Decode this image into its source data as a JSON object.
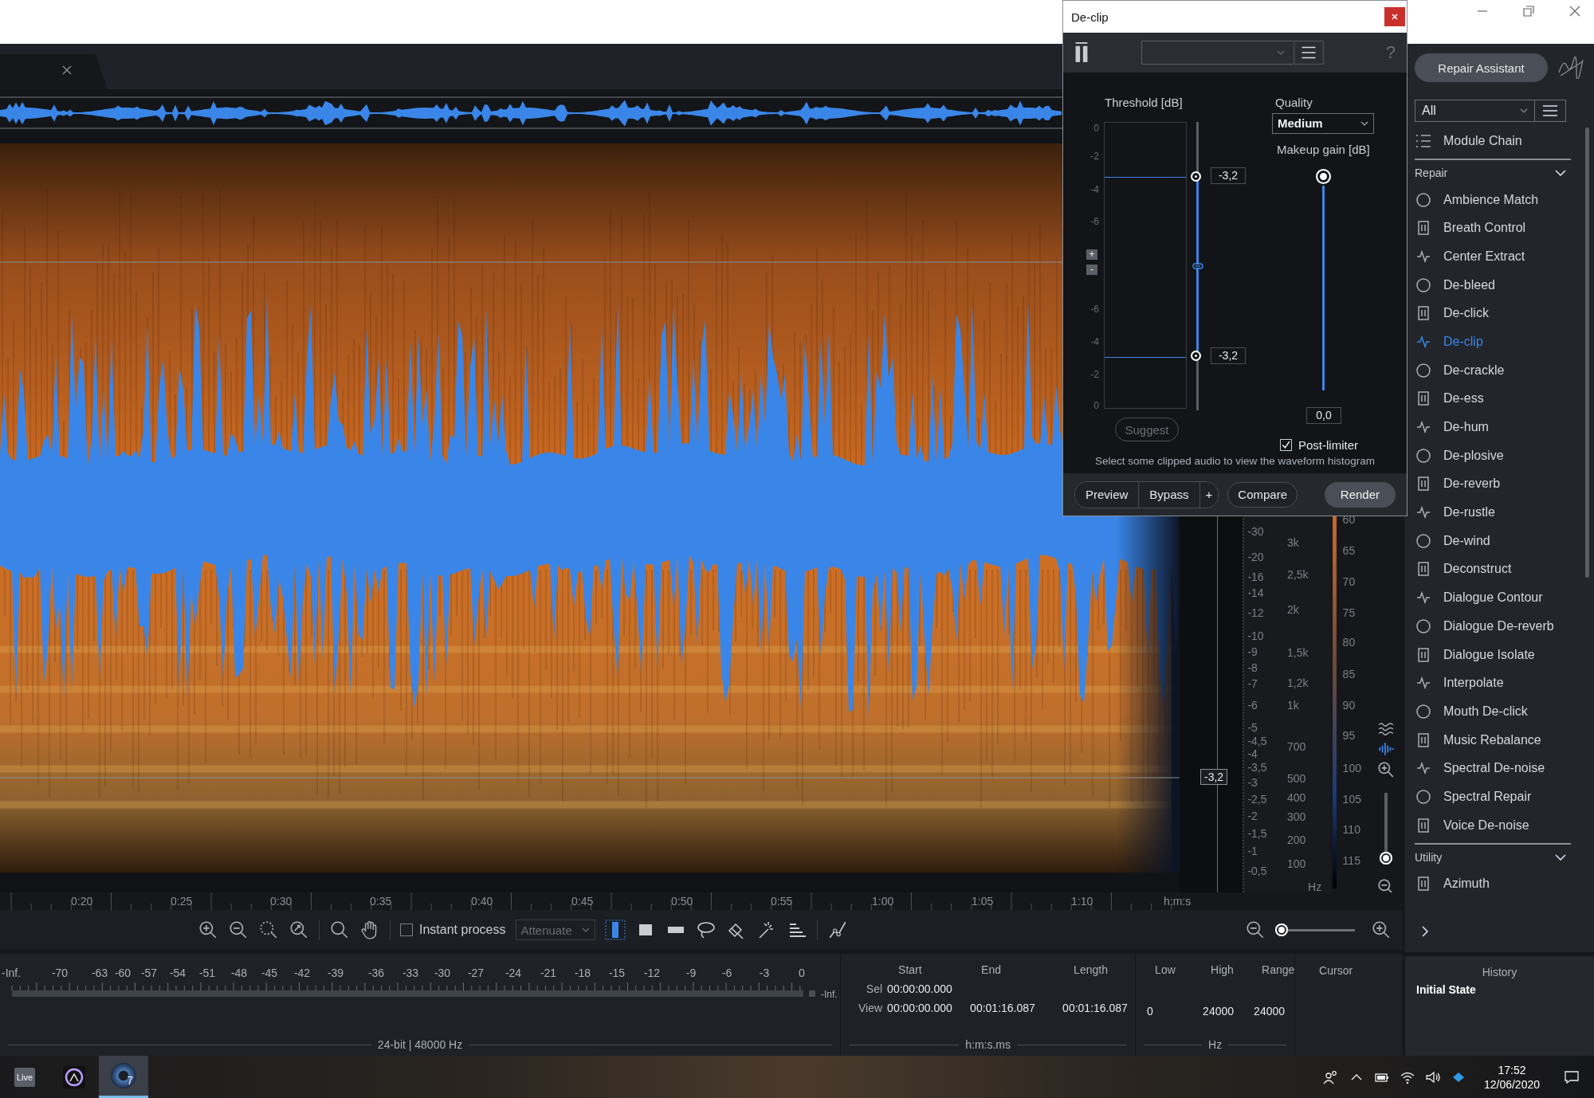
{
  "time_ruler": {
    "labels": [
      "0:20",
      "0:25",
      "0:30",
      "0:35",
      "0:40",
      "0:45",
      "0:50",
      "0:55",
      "1:00",
      "1:05",
      "1:10"
    ],
    "unit": "h:m:s"
  },
  "threshold_marker": "-3,2",
  "db_scale": [
    "-30",
    "-20",
    "-16",
    "-14",
    "-12",
    "-10",
    "-9",
    "-8",
    "-7",
    "-6",
    "-5",
    "-4,5",
    "-4",
    "-3,5",
    "-3",
    "-2,5",
    "-2",
    "-1,5",
    "-1",
    "-0,5"
  ],
  "hz_scale": [
    "3k",
    "2,5k",
    "2k",
    "1,5k",
    "1,2k",
    "1k",
    "700",
    "500",
    "400",
    "300",
    "200",
    "100"
  ],
  "hz_unit": "Hz",
  "color_scale": [
    "60",
    "65",
    "70",
    "75",
    "80",
    "85",
    "90",
    "95",
    "100",
    "105",
    "110",
    "115"
  ],
  "vertical_zoom": {
    "level": 0.08
  },
  "toolbar": {
    "instant_process": {
      "label": "Instant process",
      "checked": false
    },
    "mode": "Attenuate",
    "selection_tools": [
      {
        "kind": "time",
        "selected": true
      },
      {
        "kind": "time_frequency",
        "selected": false
      },
      {
        "kind": "frequency",
        "selected": false
      },
      {
        "kind": "lasso",
        "selected": false
      },
      {
        "kind": "brush",
        "selected": false
      },
      {
        "kind": "wand",
        "selected": false
      },
      {
        "kind": "harmonic",
        "selected": false
      }
    ],
    "horizontal_zoom": {
      "level": 0.0
    }
  },
  "meter": {
    "labels": [
      "-Inf.",
      "-70",
      "-63",
      "-60",
      "-57",
      "-54",
      "-51",
      "-48",
      "-45",
      "-42",
      "-39",
      "-36",
      "-33",
      "-30",
      "-27",
      "-24",
      "-21",
      "-18",
      "-15",
      "-12",
      "-9",
      "-6",
      "-3",
      "0"
    ],
    "peak": "-Inf.",
    "format": "24-bit | 48000 Hz"
  },
  "selection_info": {
    "headings": [
      "Start",
      "End",
      "Length"
    ],
    "sel": {
      "label": "Sel",
      "start": "00:00:00.000"
    },
    "view": {
      "label": "View",
      "values": [
        "00:00:00.000",
        "00:01:16.087",
        "00:01:16.087"
      ]
    },
    "unit": "h:m:s.ms"
  },
  "frequency_info": {
    "headings": [
      "Low",
      "High",
      "Range"
    ],
    "values": [
      "0",
      "24000",
      "24000"
    ],
    "unit": "Hz"
  },
  "cursor_info": {
    "heading": "Cursor"
  },
  "module_panel": {
    "repair_assistant": "Repair Assistant",
    "filter": "All",
    "module_chain": "Module Chain",
    "groups": [
      {
        "name": "Repair",
        "expanded": true,
        "items": [
          {
            "label": "Ambience Match",
            "selected": false
          },
          {
            "label": "Breath Control",
            "selected": false
          },
          {
            "label": "Center Extract",
            "selected": false
          },
          {
            "label": "De-bleed",
            "selected": false
          },
          {
            "label": "De-click",
            "selected": false
          },
          {
            "label": "De-clip",
            "selected": true
          },
          {
            "label": "De-crackle",
            "selected": false
          },
          {
            "label": "De-ess",
            "selected": false
          },
          {
            "label": "De-hum",
            "selected": false
          },
          {
            "label": "De-plosive",
            "selected": false
          },
          {
            "label": "De-reverb",
            "selected": false
          },
          {
            "label": "De-rustle",
            "selected": false
          },
          {
            "label": "De-wind",
            "selected": false
          },
          {
            "label": "Deconstruct",
            "selected": false
          },
          {
            "label": "Dialogue Contour",
            "selected": false
          },
          {
            "label": "Dialogue De-reverb",
            "selected": false
          },
          {
            "label": "Dialogue Isolate",
            "selected": false
          },
          {
            "label": "Interpolate",
            "selected": false
          },
          {
            "label": "Mouth De-click",
            "selected": false
          },
          {
            "label": "Music Rebalance",
            "selected": false
          },
          {
            "label": "Spectral De-noise",
            "selected": false
          },
          {
            "label": "Spectral Repair",
            "selected": false
          },
          {
            "label": "Voice De-noise",
            "selected": false
          }
        ]
      },
      {
        "name": "Utility",
        "expanded": true,
        "items": [
          {
            "label": "Azimuth",
            "selected": false
          }
        ]
      }
    ]
  },
  "history": {
    "title": "History",
    "items": [
      {
        "label": "Initial State",
        "selected": true
      }
    ]
  },
  "declip_dialog": {
    "title": "De-clip",
    "help": "?",
    "threshold": {
      "label": "Threshold [dB]",
      "axis": [
        "0",
        "-2",
        "-4",
        "-6",
        "-6",
        "-4",
        "-2",
        "0"
      ],
      "zoom_buttons": [
        "+",
        "-"
      ],
      "upper": {
        "value": "-3,2",
        "level": 0.62
      },
      "lower": {
        "value": "-3,2",
        "level": 0.62
      }
    },
    "suggest": "Suggest",
    "quality": {
      "label": "Quality",
      "value": "Medium"
    },
    "makeup_gain": {
      "label": "Makeup gain [dB]",
      "value": "0,0",
      "level": 1.0
    },
    "post_limiter": {
      "label": "Post-limiter",
      "checked": true
    },
    "message": "Select some clipped audio to view the waveform histogram",
    "buttons": [
      {
        "label": "Preview",
        "kind": "segment"
      },
      {
        "label": "Bypass",
        "kind": "segment"
      },
      {
        "label": "+",
        "kind": "segment"
      },
      {
        "label": "Compare",
        "kind": "pill"
      },
      {
        "label": "Render",
        "kind": "primary"
      }
    ]
  },
  "taskbar": {
    "apps": [
      {
        "kind": "live",
        "label": "Live",
        "selected": false
      },
      {
        "kind": "ring",
        "selected": false
      },
      {
        "kind": "disc",
        "label": "7",
        "selected": true
      }
    ],
    "clock": {
      "time": "17:52",
      "date": "12/06/2020"
    }
  }
}
